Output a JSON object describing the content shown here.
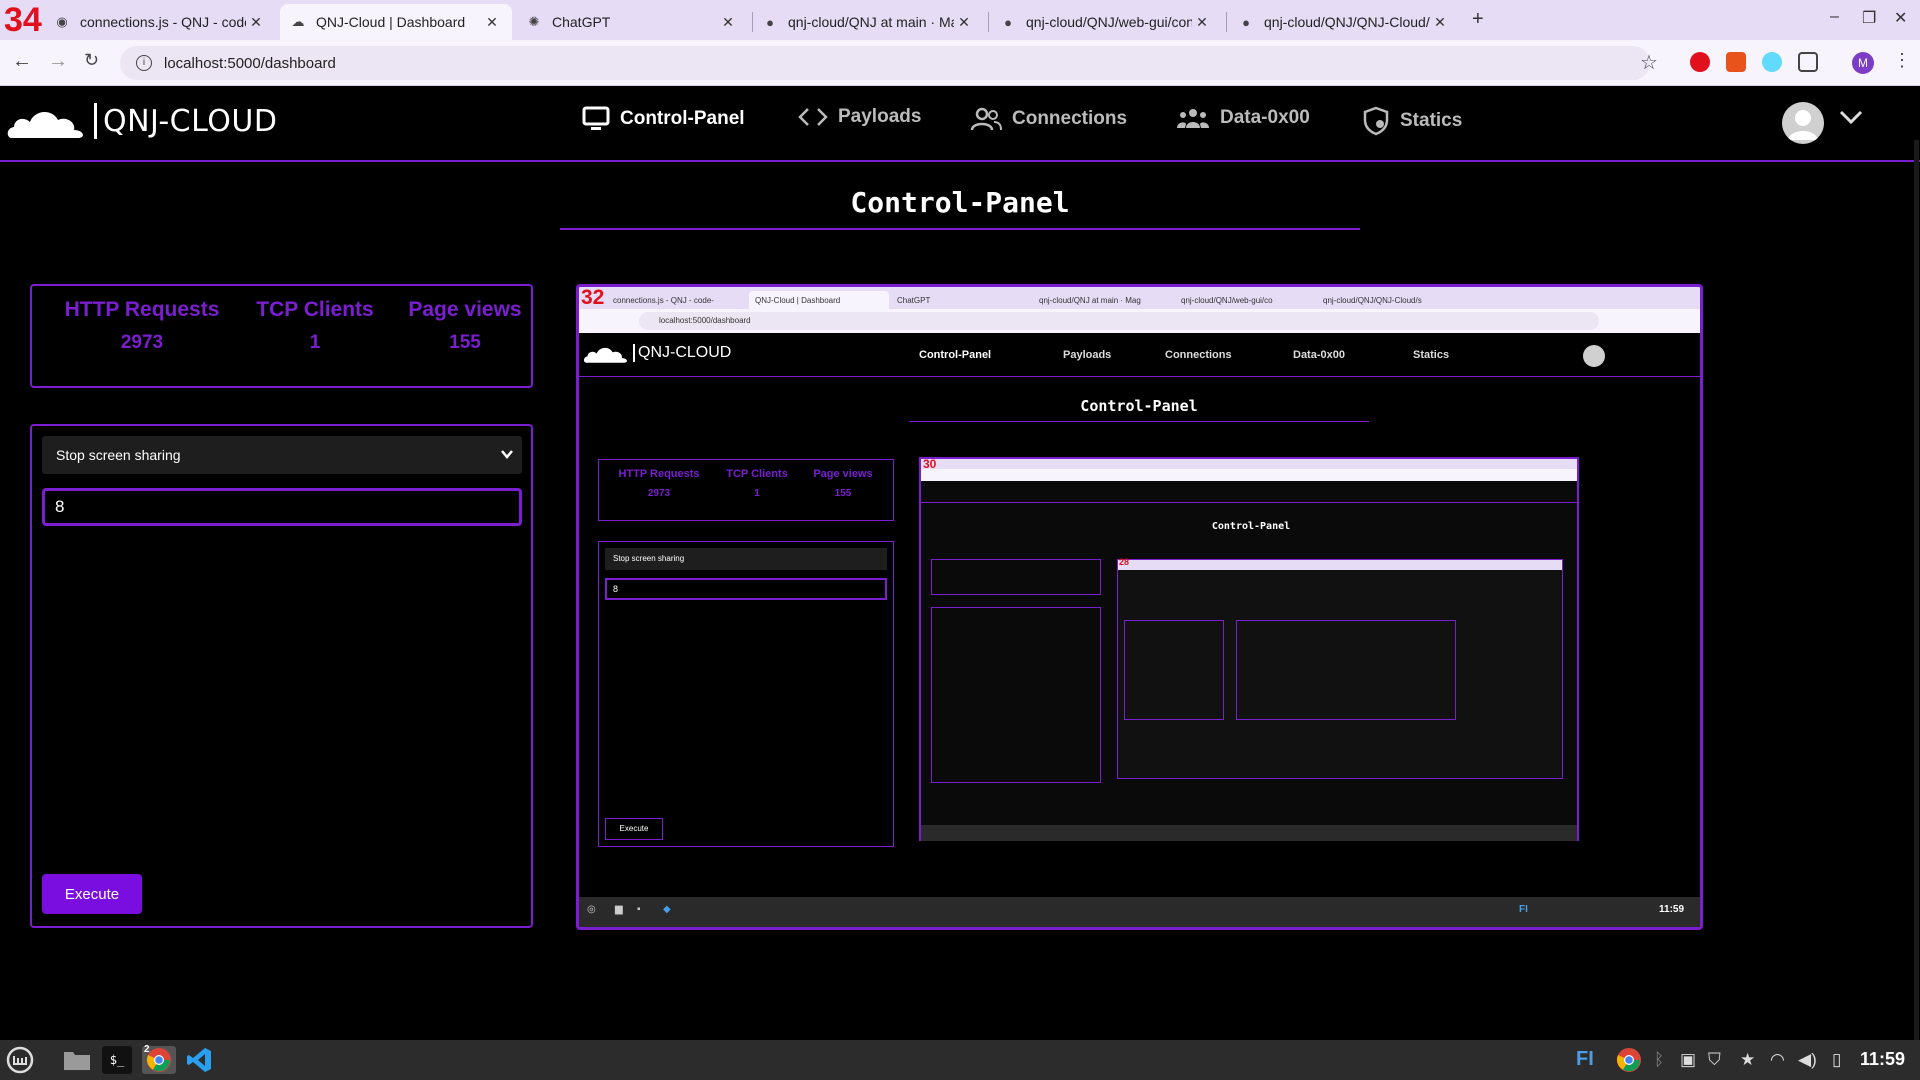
{
  "browser": {
    "tab_badge": "34",
    "tabs": [
      {
        "title": "connections.js - QNJ - code-o",
        "icon": "vscode-icon"
      },
      {
        "title": "QNJ-Cloud | Dashboard",
        "icon": "qnj-cloud-icon"
      },
      {
        "title": "ChatGPT",
        "icon": "chatgpt-icon"
      },
      {
        "title": "qnj-cloud/QNJ at main · Mag",
        "icon": "github-icon"
      },
      {
        "title": "qnj-cloud/QNJ/web-gui/con",
        "icon": "github-icon"
      },
      {
        "title": "qnj-cloud/QNJ/QNJ-Cloud/s",
        "icon": "github-icon"
      }
    ],
    "url": "localhost:5000/dashboard",
    "profile_initial": "M"
  },
  "app": {
    "logo_text": "QNJ-CLOUD",
    "nav": [
      {
        "label": "Control-Panel",
        "icon": "monitor-icon"
      },
      {
        "label": "Payloads",
        "icon": "code-brackets-icon"
      },
      {
        "label": "Connections",
        "icon": "users-icon"
      },
      {
        "label": "Data-0x00",
        "icon": "group-icon"
      },
      {
        "label": "Statics",
        "icon": "shield-icon"
      }
    ]
  },
  "page": {
    "title": "Control-Panel"
  },
  "stats": [
    {
      "label": "HTTP Requests",
      "value": "2973"
    },
    {
      "label": "TCP Clients",
      "value": "1"
    },
    {
      "label": "Page views",
      "value": "155"
    }
  ],
  "command": {
    "selected": "Stop screen sharing",
    "input_value": "8",
    "execute_label": "Execute"
  },
  "screen_share": {
    "tab_badge": "32",
    "inner_badge": "30",
    "inner_badge_2": "28",
    "tabs": [
      "connections.js - QNJ - code-",
      "QNJ-Cloud | Dashboard",
      "ChatGPT",
      "qnj-cloud/QNJ at main · Mag",
      "qnj-cloud/QNJ/web-gui/co",
      "qnj-cloud/QNJ/QNJ-Cloud/s"
    ],
    "url": "localhost:5000/dashboard",
    "logo_text": "QNJ-CLOUD",
    "nav": [
      "Control-Panel",
      "Payloads",
      "Connections",
      "Data-0x00",
      "Statics"
    ],
    "title": "Control-Panel",
    "stats": [
      {
        "label": "HTTP Requests",
        "value": "2973"
      },
      {
        "label": "TCP Clients",
        "value": "1"
      },
      {
        "label": "Page views",
        "value": "155"
      }
    ],
    "selected": "Stop screen sharing",
    "input_value": "8",
    "execute_label": "Execute",
    "inner_title": "Control-Panel",
    "taskbar_lang": "FI",
    "taskbar_clock": "11:59"
  },
  "taskbar": {
    "lang": "FI",
    "clock": "11:59",
    "chrome_badge": "2"
  },
  "colors": {
    "accent": "#7a1ed0",
    "button": "#7a0ee0",
    "background": "#000000",
    "tabbar": "#e6dcf5"
  }
}
